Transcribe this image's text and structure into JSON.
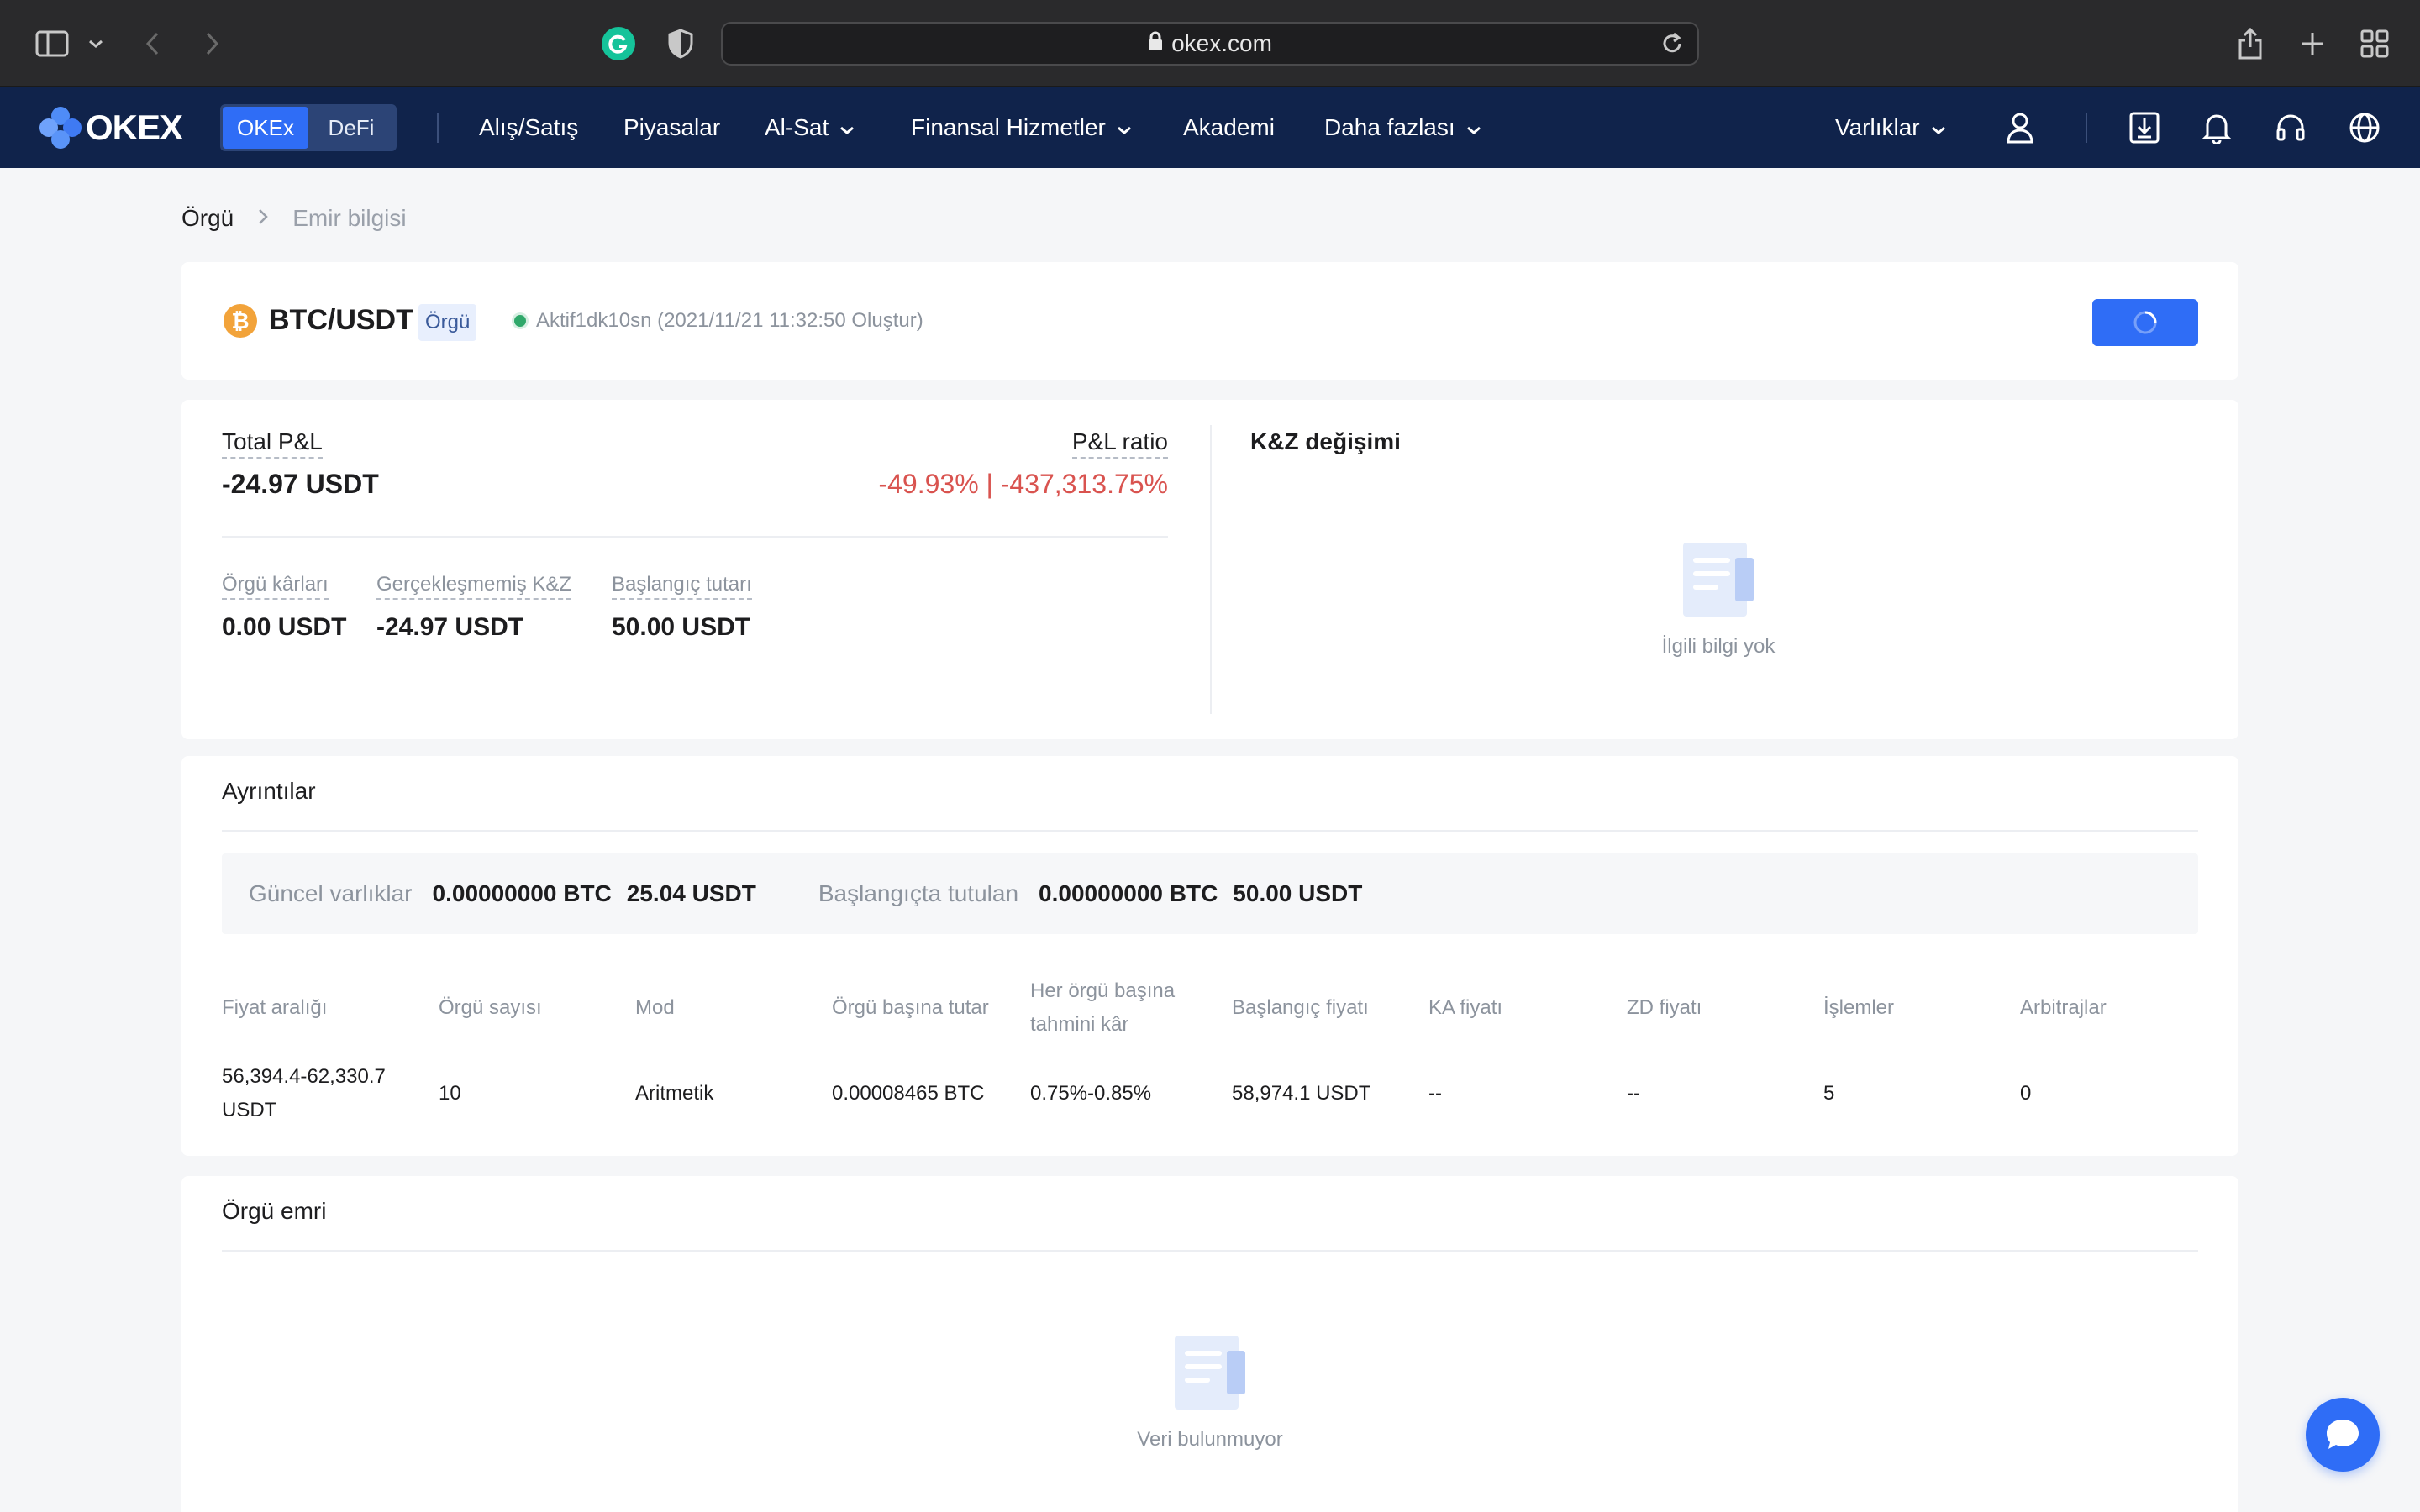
{
  "browser": {
    "url": "okex.com"
  },
  "nav": {
    "brand": "OKEX",
    "segment": {
      "active": "OKEx",
      "other": "DeFi"
    },
    "items": [
      {
        "label": "Alış/Satış"
      },
      {
        "label": "Piyasalar"
      },
      {
        "label": "Al-Sat"
      },
      {
        "label": "Finansal Hizmetler"
      },
      {
        "label": "Akademi"
      },
      {
        "label": "Daha fazlası"
      }
    ],
    "assets_label": "Varlıklar"
  },
  "breadcrumb": {
    "root": "Örgü",
    "current": "Emir bilgisi"
  },
  "header": {
    "coin_symbol": "₿",
    "pair": "BTC/USDT",
    "tag": "Örgü",
    "status": "Aktif1dk10sn (2021/11/21 11:32:50 Oluştur)"
  },
  "pnl": {
    "total_label": "Total P&L",
    "total_value": "-24.97 USDT",
    "ratio_label": "P&L ratio",
    "ratio_value": "-49.93% | -437,313.75%",
    "metrics": [
      {
        "label": "Örgü kârları",
        "value": "0.00 USDT"
      },
      {
        "label": "Gerçekleşmemiş K&Z",
        "value": "-24.97 USDT"
      },
      {
        "label": "Başlangıç tutarı",
        "value": "50.00 USDT"
      }
    ],
    "change_title": "K&Z değişimi",
    "empty_text": "İlgili bilgi yok"
  },
  "details": {
    "title": "Ayrıntılar",
    "current_label": "Güncel varlıklar",
    "current_btc": "0.00000000 BTC",
    "current_usdt": "25.04 USDT",
    "initial_label": "Başlangıçta tutulan",
    "initial_btc": "0.00000000 BTC",
    "initial_usdt": "50.00 USDT",
    "columns": [
      {
        "line1": "Fiyat aralığı",
        "line2": ""
      },
      {
        "line1": "Örgü sayısı",
        "line2": ""
      },
      {
        "line1": "Mod",
        "line2": ""
      },
      {
        "line1": "Örgü başına tutar",
        "line2": ""
      },
      {
        "line1": "Her örgü başına",
        "line2": "tahmini kâr"
      },
      {
        "line1": "Başlangıç fiyatı",
        "line2": ""
      },
      {
        "line1": "KA fiyatı",
        "line2": ""
      },
      {
        "line1": "ZD fiyatı",
        "line2": ""
      },
      {
        "line1": "İşlemler",
        "line2": ""
      },
      {
        "line1": "Arbitrajlar",
        "line2": ""
      }
    ],
    "row": [
      {
        "line1": "56,394.4-62,330.7",
        "line2": "USDT"
      },
      {
        "line1": "10",
        "line2": ""
      },
      {
        "line1": "Aritmetik",
        "line2": ""
      },
      {
        "line1": "0.00008465 BTC",
        "line2": ""
      },
      {
        "line1": "0.75%-0.85%",
        "line2": ""
      },
      {
        "line1": "58,974.1 USDT",
        "line2": ""
      },
      {
        "line1": "--",
        "line2": ""
      },
      {
        "line1": "--",
        "line2": ""
      },
      {
        "line1": "5",
        "line2": ""
      },
      {
        "line1": "0",
        "line2": ""
      }
    ]
  },
  "orders": {
    "title": "Örgü emri",
    "empty_text": "Veri bulunmuyor"
  },
  "colors": {
    "nav_bg": "#10234b",
    "accent": "#2f6df6",
    "negative": "#d9534f",
    "status_green": "#2fa86a"
  }
}
